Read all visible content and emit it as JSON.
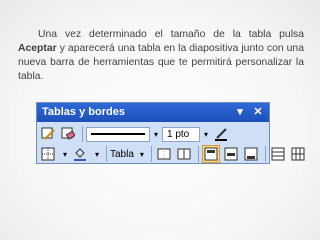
{
  "slide": {
    "text_before": "Una vez determinado el tamaño de la tabla pulsa ",
    "text_bold": "Aceptar",
    "text_after": " y aparecerá una tabla en la diapositiva junto con una nueva barra de herramientas que te permitirá personalizar la tabla."
  },
  "toolbar": {
    "title": "Tablas y bordes",
    "dropdown_arrow": "▾",
    "close_glyph": "✕",
    "line_weight": "1 pto",
    "table_menu_label": "Tabla",
    "accent_active": "#f9d98a",
    "titlebar_color": "#2f6ad9"
  }
}
